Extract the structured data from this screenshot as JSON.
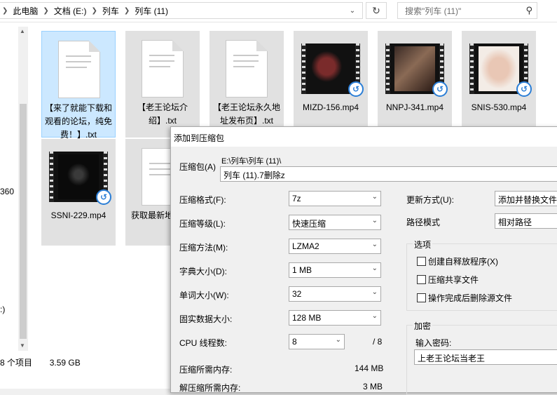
{
  "explorer": {
    "breadcrumb": [
      "此电脑",
      "文档 (E:)",
      "列车",
      "列车 (11)"
    ],
    "search_placeholder": "搜索\"列车 (11)\"",
    "nav_texts": [
      "360",
      ":)"
    ],
    "status": {
      "count": "8 个项目",
      "size": "3.59 GB"
    },
    "files": [
      {
        "name": "【来了就能下载和观看的论坛，纯免费！】.txt",
        "kind": "txt"
      },
      {
        "name": "【老王论坛介绍】.txt",
        "kind": "txt"
      },
      {
        "name": "【老王论坛永久地址发布页】.txt",
        "kind": "txt"
      },
      {
        "name": "MIZD-156.mp4",
        "kind": "video"
      },
      {
        "name": "NNPJ-341.mp4",
        "kind": "video"
      },
      {
        "name": "SNIS-530.mp4",
        "kind": "video"
      },
      {
        "name": "SSNI-229.mp4",
        "kind": "video"
      },
      {
        "name": "获取最新地",
        "kind": "txt"
      }
    ]
  },
  "dialog": {
    "title": "添加到压缩包",
    "archive_label": "压缩包(A)",
    "archive_path": "E:\\列车\\列车 (11)\\",
    "archive_name": "列车 (11).7删除z",
    "format_label": "压缩格式(F):",
    "format_value": "7z",
    "level_label": "压缩等级(L):",
    "level_value": "快速压缩",
    "method_label": "压缩方法(M):",
    "method_value": "LZMA2",
    "dict_label": "字典大小(D):",
    "dict_value": "1 MB",
    "word_label": "单词大小(W):",
    "word_value": "32",
    "solid_label": "固实数据大小:",
    "solid_value": "128 MB",
    "cpu_label": "CPU 线程数:",
    "cpu_value": "8",
    "cpu_total": "/ 8",
    "mem_comp_label": "压缩所需内存:",
    "mem_comp_value": "144 MB",
    "mem_decomp_label": "解压缩所需内存:",
    "mem_decomp_value": "3 MB",
    "update_label": "更新方式(U):",
    "update_value": "添加并替换文件",
    "pathmode_label": "路径模式",
    "pathmode_value": "相对路径",
    "options_title": "选项",
    "options": [
      "创建自释放程序(X)",
      "压缩共享文件",
      "操作完成后删除源文件"
    ],
    "encrypt_title": "加密",
    "password_label": "输入密码:",
    "password_value": "上老王论坛当老王"
  }
}
